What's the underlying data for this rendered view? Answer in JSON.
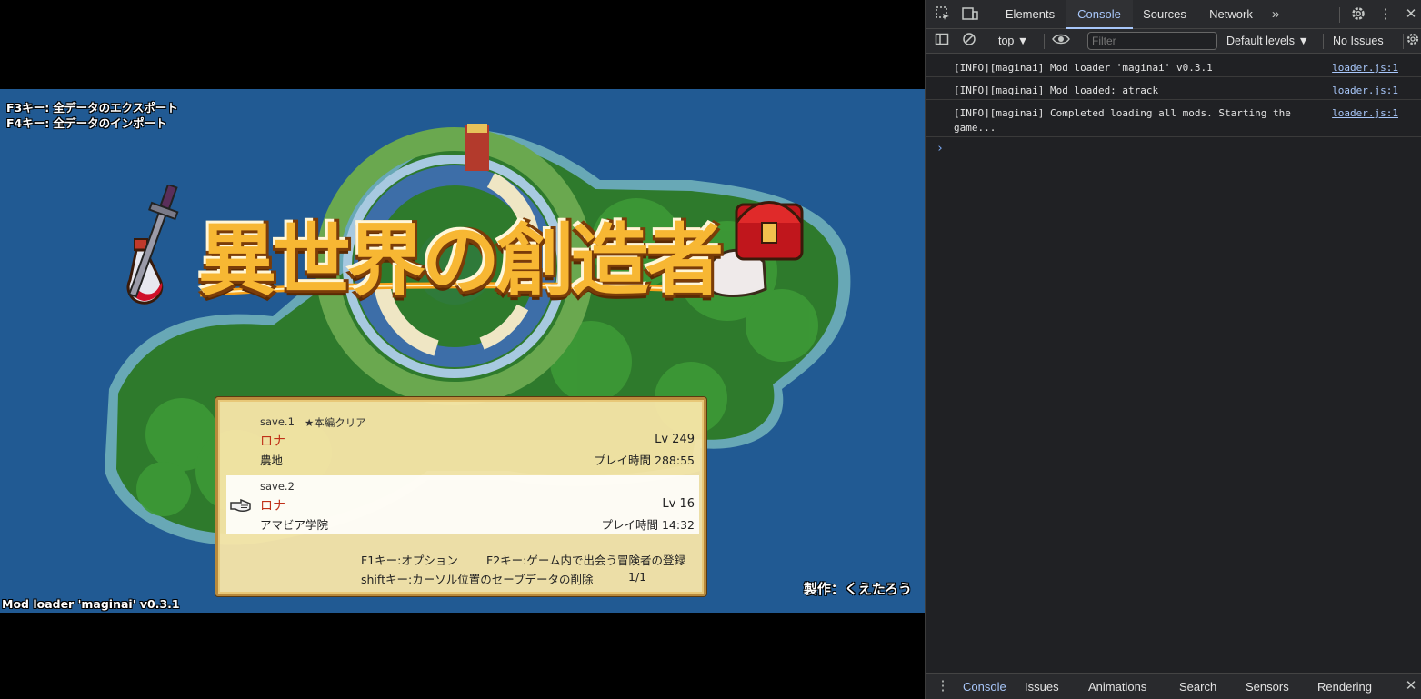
{
  "game": {
    "hint_f3": "F3キー: 全データのエクスポート",
    "hint_f4": "F4キー: 全データのインポート",
    "title": "異世界の創造者",
    "mod_version": "Mod loader 'maginai' v0.3.1",
    "credit": "製作：くえたろう",
    "saves": [
      {
        "slot": "save.1",
        "badge": "★本編クリア",
        "name": "ロナ",
        "level": "Lv 249",
        "place": "農地",
        "playtime": "プレイ時間 288:55",
        "selected": false
      },
      {
        "slot": "save.2",
        "badge": "",
        "name": "ロナ",
        "level": "Lv 16",
        "place": "アマビア学院",
        "playtime": "プレイ時間 14:32",
        "selected": true
      }
    ],
    "help_f1": "F1キー:オプション",
    "help_f2": "F2キー:ゲーム内で出会う冒険者の登録",
    "help_shift": "shiftキー:カーソル位置のセーブデータの削除",
    "page": "1/1"
  },
  "devtools": {
    "tabs": [
      "Elements",
      "Console",
      "Sources",
      "Network"
    ],
    "active_tab": "Console",
    "toolbar": {
      "context": "top",
      "filter_placeholder": "Filter",
      "levels": "Default levels",
      "issues": "No Issues"
    },
    "logs": [
      {
        "message": "[INFO][maginai] Mod loader 'maginai' v0.3.1",
        "source": "loader.js:1"
      },
      {
        "message": "[INFO][maginai] Mod loaded: atrack",
        "source": "loader.js:1"
      },
      {
        "message": "[INFO][maginai] Completed loading all mods. Starting the game...",
        "source": "loader.js:1"
      }
    ],
    "drawer_tabs": [
      "Console",
      "Issues",
      "Animations",
      "Search",
      "Sensors",
      "Rendering"
    ],
    "accent": "#a8c7fa"
  }
}
